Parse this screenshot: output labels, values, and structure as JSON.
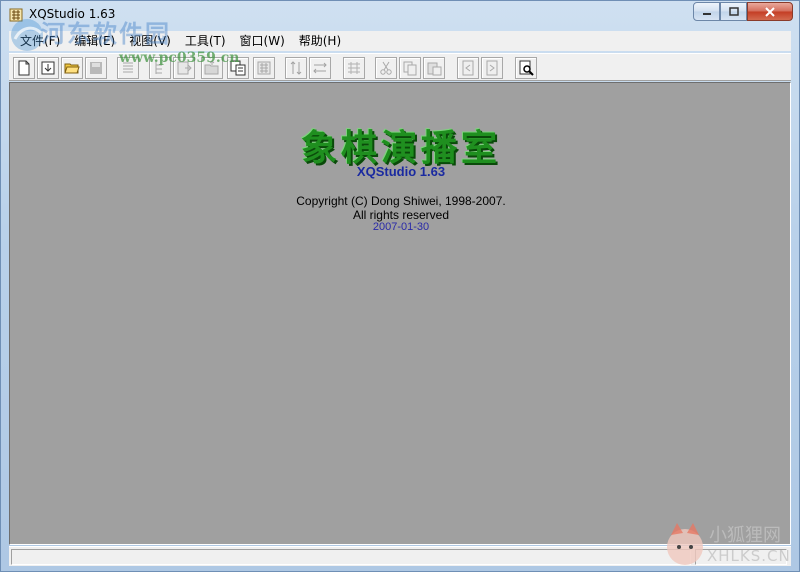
{
  "window": {
    "title": "XQStudio 1.63"
  },
  "watermark": {
    "site_name": "河东软件园",
    "site_url": "www.pc0359.cn",
    "corner_name": "小狐狸网",
    "corner_url": "XHLKS.CN"
  },
  "menubar": {
    "items": [
      {
        "label": "文件(F)"
      },
      {
        "label": "编辑(E)"
      },
      {
        "label": "视图(V)"
      },
      {
        "label": "工具(T)"
      },
      {
        "label": "窗口(W)"
      },
      {
        "label": "帮助(H)"
      }
    ]
  },
  "toolbar": {
    "buttons": [
      {
        "icon": "new-file-icon",
        "enabled": true
      },
      {
        "icon": "import-icon",
        "enabled": true
      },
      {
        "icon": "open-folder-icon",
        "enabled": true
      },
      {
        "icon": "save-icon",
        "enabled": false
      },
      {
        "icon": "list-icon",
        "enabled": false
      },
      {
        "icon": "tree-icon",
        "enabled": false
      },
      {
        "icon": "export-icon",
        "enabled": false
      },
      {
        "icon": "folder-out-icon",
        "enabled": false
      },
      {
        "icon": "board-copy-icon",
        "enabled": true
      },
      {
        "icon": "board-paste-icon",
        "enabled": false
      },
      {
        "icon": "flip-vertical-icon",
        "enabled": false
      },
      {
        "icon": "flip-horizontal-icon",
        "enabled": false
      },
      {
        "icon": "step-icon",
        "enabled": false
      },
      {
        "icon": "cut-icon",
        "enabled": false
      },
      {
        "icon": "copy-icon",
        "enabled": false
      },
      {
        "icon": "paste-icon",
        "enabled": false
      },
      {
        "icon": "page-prev-icon",
        "enabled": false
      },
      {
        "icon": "page-next-icon",
        "enabled": false
      },
      {
        "icon": "preview-icon",
        "enabled": true
      }
    ]
  },
  "splash": {
    "title": "象棋演播室",
    "version": "XQStudio 1.63",
    "copyright": "Copyright (C) Dong Shiwei, 1998-2007.",
    "rights": "All rights reserved",
    "date": "2007-01-30"
  },
  "colors": {
    "client_bg": "#a0a0a0",
    "title_green": "#1f8f1f",
    "version_blue": "#1a2aa0",
    "chrome": "#f0f0f0"
  }
}
